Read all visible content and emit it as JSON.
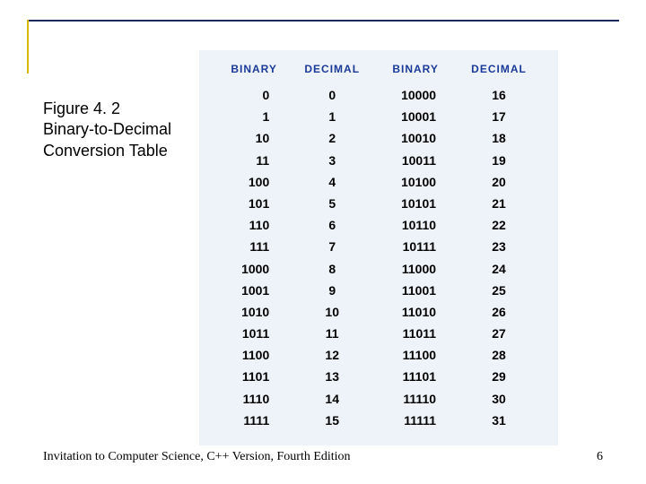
{
  "caption": {
    "line1": "Figure 4. 2",
    "line2": "Binary-to-Decimal",
    "line3": "Conversion Table"
  },
  "headers": {
    "h1": "BINARY",
    "h2": "DECIMAL",
    "h3": "BINARY",
    "h4": "DECIMAL"
  },
  "chart_data": {
    "type": "table",
    "title": "Binary-to-Decimal Conversion Table",
    "columns": [
      "Binary",
      "Decimal",
      "Binary",
      "Decimal"
    ],
    "rows": [
      {
        "b1": "0",
        "d1": "0",
        "b2": "10000",
        "d2": "16"
      },
      {
        "b1": "1",
        "d1": "1",
        "b2": "10001",
        "d2": "17"
      },
      {
        "b1": "10",
        "d1": "2",
        "b2": "10010",
        "d2": "18"
      },
      {
        "b1": "11",
        "d1": "3",
        "b2": "10011",
        "d2": "19"
      },
      {
        "b1": "100",
        "d1": "4",
        "b2": "10100",
        "d2": "20"
      },
      {
        "b1": "101",
        "d1": "5",
        "b2": "10101",
        "d2": "21"
      },
      {
        "b1": "110",
        "d1": "6",
        "b2": "10110",
        "d2": "22"
      },
      {
        "b1": "111",
        "d1": "7",
        "b2": "10111",
        "d2": "23"
      },
      {
        "b1": "1000",
        "d1": "8",
        "b2": "11000",
        "d2": "24"
      },
      {
        "b1": "1001",
        "d1": "9",
        "b2": "11001",
        "d2": "25"
      },
      {
        "b1": "1010",
        "d1": "10",
        "b2": "11010",
        "d2": "26"
      },
      {
        "b1": "1011",
        "d1": "11",
        "b2": "11011",
        "d2": "27"
      },
      {
        "b1": "1100",
        "d1": "12",
        "b2": "11100",
        "d2": "28"
      },
      {
        "b1": "1101",
        "d1": "13",
        "b2": "11101",
        "d2": "29"
      },
      {
        "b1": "1110",
        "d1": "14",
        "b2": "11110",
        "d2": "30"
      },
      {
        "b1": "1111",
        "d1": "15",
        "b2": "11111",
        "d2": "31"
      }
    ]
  },
  "footer": {
    "text": "Invitation to Computer Science, C++ Version, Fourth Edition",
    "page": "6"
  }
}
